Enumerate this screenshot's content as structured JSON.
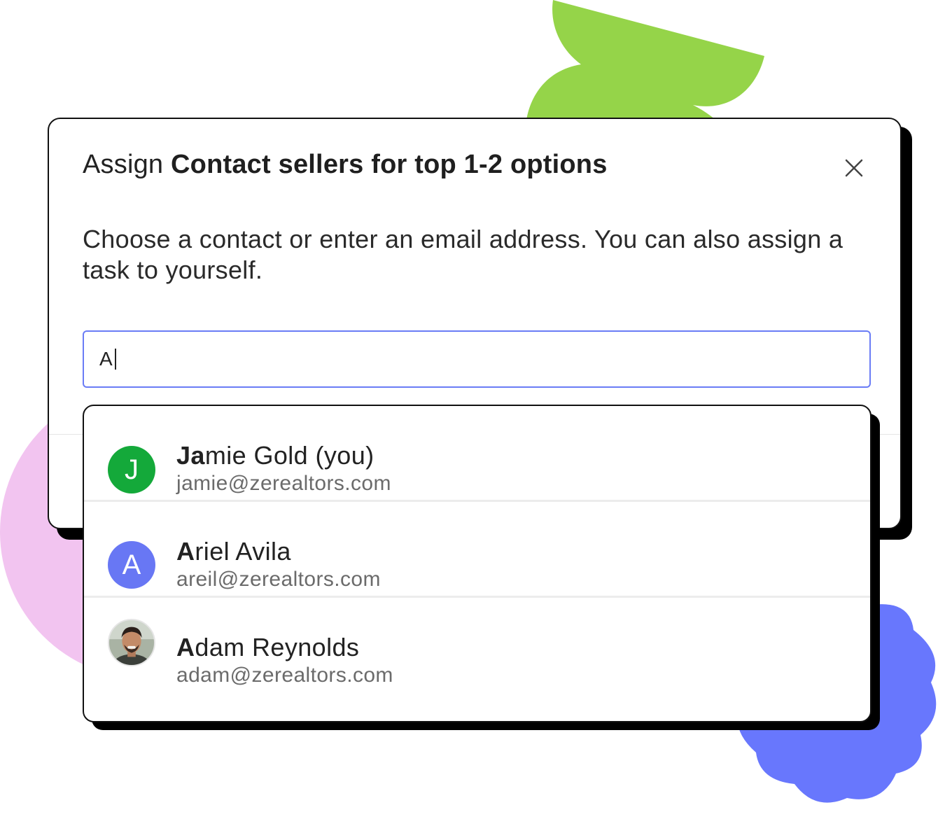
{
  "dialog": {
    "title_prefix": "Assign",
    "task_name": "Contact sellers for top 1-2 options",
    "description": "Choose a contact or enter an email address. You can also assign a task to yourself.",
    "close_icon": "close-icon"
  },
  "search": {
    "value": "A"
  },
  "contacts": [
    {
      "name_highlight": "Ja",
      "name_rest": "mie Gold (you)",
      "email": "jamie@zerealtors.com",
      "avatar_initial": "J",
      "avatar_color": "#14a93a"
    },
    {
      "name_highlight": "A",
      "name_rest": "riel Avila",
      "email": "areil@zerealtors.com",
      "avatar_initial": "A",
      "avatar_color": "#6877f4"
    },
    {
      "name_highlight": "A",
      "name_rest": "dam Reynolds",
      "email": "adam@zerealtors.com",
      "avatar_type": "photo"
    }
  ],
  "colors": {
    "accent": "#6a7cf6",
    "leaf_green": "#95d449",
    "blob_pink": "#f2c4f0",
    "badge_blue": "#6877fd"
  }
}
